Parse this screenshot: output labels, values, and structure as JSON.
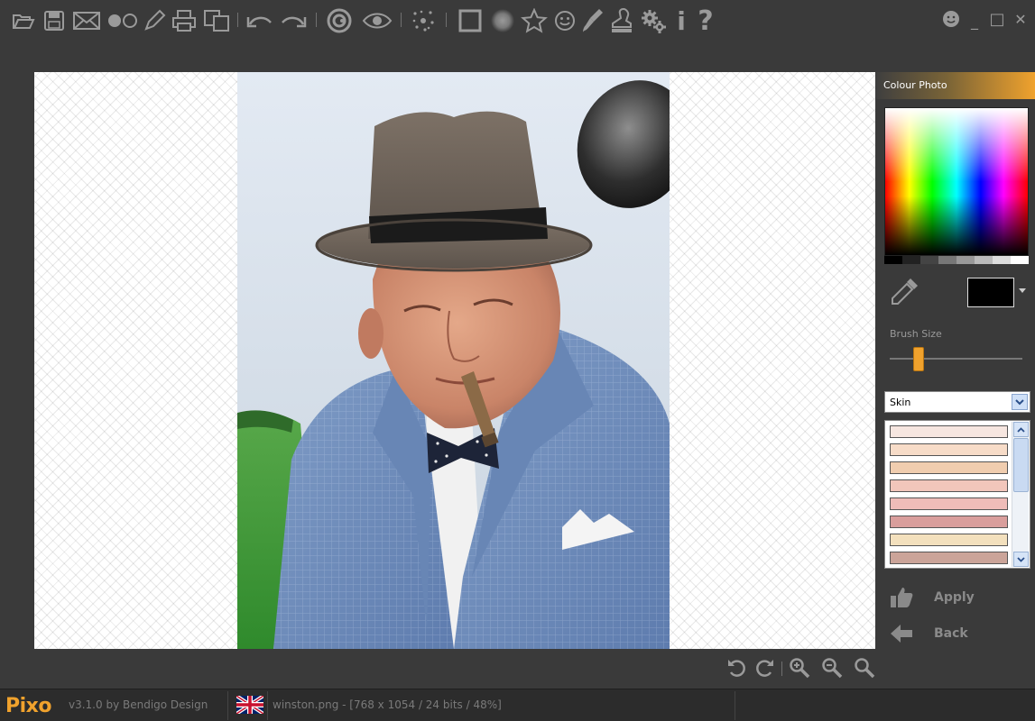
{
  "app": {
    "name": "Pixo",
    "version_label": "v3.1.0 by Bendigo Design"
  },
  "toolbar": {
    "icons": [
      "open-icon",
      "save-icon",
      "email-icon",
      "circles-icon",
      "pencil-icon",
      "print-icon",
      "copy-icon",
      "undo-icon",
      "redo-icon",
      "spiral-icon",
      "eye-icon",
      "sparkle-icon",
      "square-icon",
      "blur-icon",
      "star-icon",
      "smiley-icon",
      "dropper-brush-icon",
      "stamp-icon",
      "gears-icon",
      "info-icon",
      "help-icon"
    ],
    "info_glyph": "i",
    "help_glyph": "?"
  },
  "window_controls": {
    "minimize": "_",
    "maximize": "□",
    "close": "✕"
  },
  "panel": {
    "title": "Colour Photo",
    "brush_size_label": "Brush Size",
    "brush_size_value": 0.22,
    "selected_color": "#000000",
    "palette_select": "Skin",
    "swatches": [
      "#f6e6e0",
      "#f7dcc8",
      "#f0cdaf",
      "#f2c6bb",
      "#efbcb8",
      "#d99e9c",
      "#f3e0bd",
      "#cba499"
    ],
    "apply_label": "Apply",
    "back_label": "Back"
  },
  "status": {
    "file_info": "winston.png - [768 x 1054 / 24 bits / 48%]"
  },
  "colors": {
    "accent": "#f0a22d",
    "background": "#3a3a3a"
  }
}
